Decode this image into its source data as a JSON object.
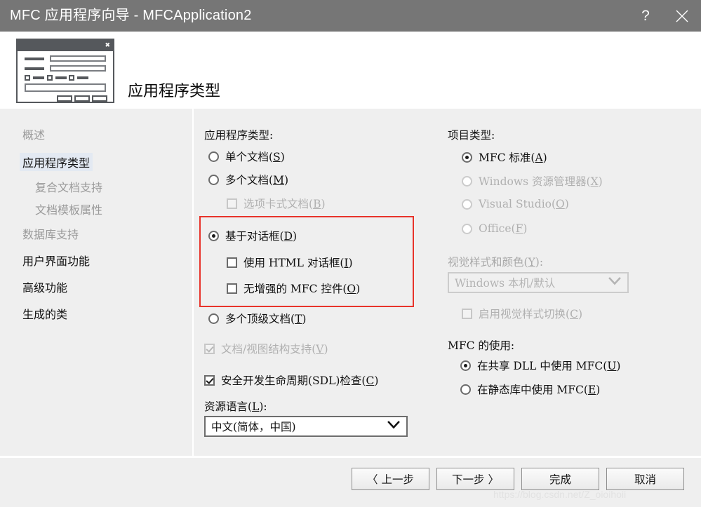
{
  "window": {
    "title": "MFC 应用程序向导 - MFCApplication2",
    "help_label": "?",
    "close_label": "×"
  },
  "header": {
    "page_title": "应用程序类型",
    "icon_name": "dialog-preview-icon",
    "icon_close_glyph": "✖"
  },
  "sidebar": {
    "items": [
      {
        "label": "概述",
        "state": "disabled",
        "indent": false,
        "selected": false
      },
      {
        "label": "应用程序类型",
        "state": "enabled",
        "indent": false,
        "selected": true
      },
      {
        "label": "复合文档支持",
        "state": "disabled",
        "indent": true,
        "selected": false
      },
      {
        "label": "文档模板属性",
        "state": "disabled",
        "indent": true,
        "selected": false
      },
      {
        "label": "数据库支持",
        "state": "disabled",
        "indent": false,
        "selected": false
      },
      {
        "label": "用户界面功能",
        "state": "enabled",
        "indent": false,
        "selected": false
      },
      {
        "label": "高级功能",
        "state": "enabled",
        "indent": false,
        "selected": false
      },
      {
        "label": "生成的类",
        "state": "enabled",
        "indent": false,
        "selected": false
      }
    ]
  },
  "left_column": {
    "app_type_label": "应用程序类型:",
    "options": {
      "single_doc": "单个文档(S)",
      "multi_doc": "多个文档(M)",
      "tabbed_doc": "选项卡式文档(B)",
      "dialog_based": "基于对话框(D)",
      "use_html_dialog": "使用 HTML 对话框(I)",
      "no_enhanced_mfc": "无增强的 MFC 控件(O)",
      "multi_top_level": "多个顶级文档(T)",
      "doc_view_support": "文档/视图结构支持(V)",
      "sdl_checks": "安全开发生命周期(SDL)检查(C)"
    },
    "resource_language_label": "资源语言(L):",
    "resource_language_value": "中文(简体，中国)"
  },
  "right_column": {
    "project_type_label": "项目类型:",
    "options": {
      "mfc_standard": "MFC 标准(A)",
      "windows_explorer": "Windows 资源管理器(X)",
      "visual_studio": "Visual Studio(O)",
      "office": "Office(F)"
    },
    "visual_style_label": "视觉样式和颜色(Y):",
    "visual_style_value": "Windows 本机/默认",
    "enable_visual_style_switching": "启用视觉样式切换(C)",
    "mfc_use_label": "MFC 的使用:",
    "mfc_use_options": {
      "shared_dll": "在共享 DLL 中使用 MFC(U)",
      "static_lib": "在静态库中使用 MFC(E)"
    }
  },
  "footer": {
    "back": "〈 上一步",
    "next": "下一步 〉",
    "finish": "完成",
    "cancel": "取消"
  },
  "watermark": "https://blog.csdn.net/Z_oioihoii",
  "colors": {
    "titlebar_bg": "#767676",
    "body_bg": "#efefef",
    "header_bg": "#ffffff",
    "selection_bg": "#e3e9f2",
    "annotation_red": "#e8332a",
    "disabled_text": "#b0b0b0"
  }
}
